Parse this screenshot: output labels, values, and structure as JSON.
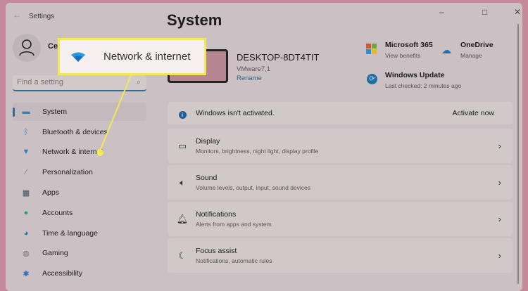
{
  "window": {
    "title": "Settings",
    "back_icon": "arrow-left",
    "minimize": "–",
    "maximize": "□",
    "close": "✕"
  },
  "user": {
    "name": "Ce"
  },
  "search": {
    "placeholder": "Find a setting"
  },
  "sidebar": {
    "items": [
      {
        "label": "System",
        "icon": "monitor"
      },
      {
        "label": "Bluetooth & devices",
        "icon": "bluetooth"
      },
      {
        "label": "Network & internet",
        "icon": "wifi"
      },
      {
        "label": "Personalization",
        "icon": "brush"
      },
      {
        "label": "Apps",
        "icon": "apps"
      },
      {
        "label": "Accounts",
        "icon": "person"
      },
      {
        "label": "Time & language",
        "icon": "globe"
      },
      {
        "label": "Gaming",
        "icon": "controller"
      },
      {
        "label": "Accessibility",
        "icon": "accessibility"
      }
    ]
  },
  "main": {
    "title": "System",
    "device": {
      "name": "DESKTOP-8DT4TIT",
      "model": "VMware7,1",
      "rename": "Rename"
    },
    "quick": [
      {
        "title": "Microsoft 365",
        "sub": "View benefits"
      },
      {
        "title": "OneDrive",
        "sub": "Manage"
      },
      {
        "title": "Windows Update",
        "sub": "Last checked: 2 minutes ago"
      }
    ],
    "activation": {
      "text": "Windows isn't activated.",
      "action": "Activate now"
    },
    "cards": [
      {
        "title": "Display",
        "sub": "Monitors, brightness, night light, display profile"
      },
      {
        "title": "Sound",
        "sub": "Volume levels, output, input, sound devices"
      },
      {
        "title": "Notifications",
        "sub": "Alerts from apps and system"
      },
      {
        "title": "Focus assist",
        "sub": "Notifications, automatic rules"
      }
    ]
  },
  "callout": {
    "label": "Network & internet",
    "highlight_color": "#f2e85a"
  }
}
